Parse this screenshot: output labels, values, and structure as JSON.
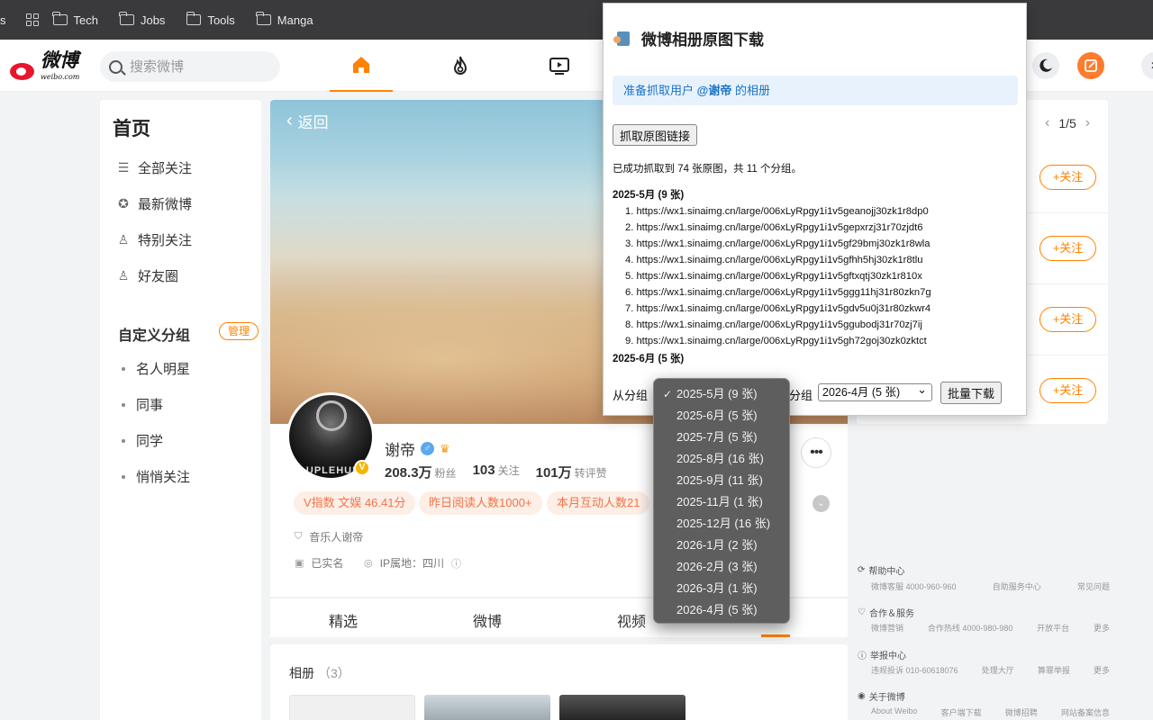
{
  "bookmarks": {
    "items": [
      "Tech",
      "Jobs",
      "Tools",
      "Manga"
    ]
  },
  "topnav": {
    "logo_text": "微博",
    "logo_sub": "weibo.com",
    "search_placeholder": "搜索微博"
  },
  "sidebar": {
    "title": "首页",
    "nav": [
      "全部关注",
      "最新微博",
      "特别关注",
      "好友圈"
    ],
    "group_title": "自定义分组",
    "manage_label": "管理",
    "groups": [
      "名人明星",
      "同事",
      "同学",
      "悄悄关注"
    ]
  },
  "profile": {
    "back_label": "返回",
    "avatar_band": "UPLEHUN",
    "name": "谢帝",
    "followers": "208.3万",
    "followers_label": "粉丝",
    "following": "103",
    "following_label": "关注",
    "reposts": "101万",
    "reposts_label": "转评赞",
    "tags": [
      "V指数 文娱 46.41分",
      "昨日阅读人数1000+",
      "本月互动人数21"
    ],
    "bio": "音乐人谢帝",
    "verified": "已实名",
    "ip_location": "IP属地：四川"
  },
  "tabs": [
    "精选",
    "微博",
    "视频"
  ],
  "album": {
    "title": "相册",
    "count": "（3）"
  },
  "rightcol": {
    "pager": "1/5",
    "follow_label": "+关注"
  },
  "footer": {
    "sections": [
      {
        "title": "帮助中心",
        "links": [
          "微博客服 4000-960-960",
          "自助服务中心",
          "常见问题"
        ]
      },
      {
        "title": "合作＆服务",
        "links": [
          "微博营销",
          "合作热线 4000-980-980",
          "开放平台",
          "更多"
        ]
      },
      {
        "title": "举报中心",
        "links": [
          "违规投诉 010-60618076",
          "处理大厅",
          "算罪举报",
          "更多"
        ]
      },
      {
        "title": "关于微博",
        "links": [
          "About Weibo",
          "客户端下载",
          "微博招聘",
          "网站备案信息"
        ]
      }
    ]
  },
  "popup": {
    "title": "微博相册原图下载",
    "banner_prefix": "准备抓取用户",
    "banner_user": "@谢帝",
    "banner_suffix": "的相册",
    "fetch_button": "抓取原图链接",
    "status": "已成功抓取到 74 张原图，共 11 个分组。",
    "group1_title": "2025-5月 (9 张)",
    "urls": [
      "https://wx1.sinaimg.cn/large/006xLyRpgy1i1v5geanojj30zk1r8dp0",
      "https://wx1.sinaimg.cn/large/006xLyRpgy1i1v5gepxrzj31r70zjdt6",
      "https://wx1.sinaimg.cn/large/006xLyRpgy1i1v5gf29bmj30zk1r8wla",
      "https://wx1.sinaimg.cn/large/006xLyRpgy1i1v5gfhh5hj30zk1r8tlu",
      "https://wx1.sinaimg.cn/large/006xLyRpgy1i1v5gftxqtj30zk1r810x",
      "https://wx1.sinaimg.cn/large/006xLyRpgy1i1v5ggg11hj31r80zkn7g",
      "https://wx1.sinaimg.cn/large/006xLyRpgy1i1v5gdv5u0j31r80zkwr4",
      "https://wx1.sinaimg.cn/large/006xLyRpgy1i1v5ggubodj31r70zj7ij",
      "https://wx1.sinaimg.cn/large/006xLyRpgy1i1v5gh72goj30zk0zktct"
    ],
    "group2_title": "2025-6月 (5 张)",
    "from_label": "从分组",
    "to_label": "分组",
    "to_selected": "2026-4月 (5 张)",
    "download_button": "批量下载"
  },
  "dropdown": {
    "selected": "2025-5月 (9 张)",
    "options": [
      "2025-5月 (9 张)",
      "2025-6月 (5 张)",
      "2025-7月 (5 张)",
      "2025-8月 (16 张)",
      "2025-9月 (11 张)",
      "2025-11月 (1 张)",
      "2025-12月 (16 张)",
      "2026-1月 (2 张)",
      "2026-2月 (3 张)",
      "2026-3月 (1 张)",
      "2026-4月 (5 张)"
    ]
  },
  "colors": {
    "accent": "#ff8200",
    "tag_text": "#f2744a",
    "popup_link": "#1a73c8"
  }
}
